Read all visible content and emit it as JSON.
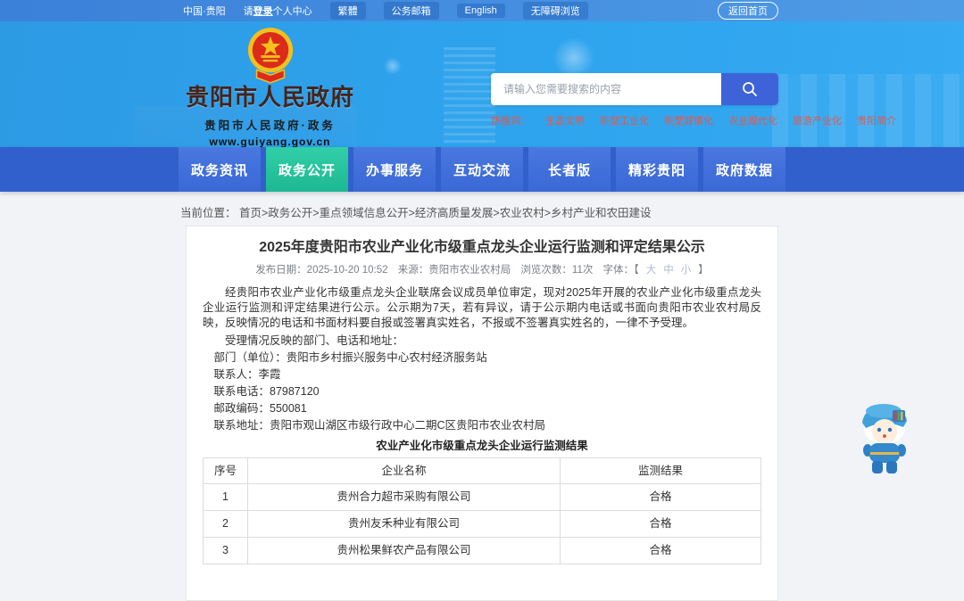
{
  "topbar": {
    "region": "中国·贵阳",
    "login_prefix": "请",
    "login_strong": "登录",
    "login_suffix": "个人中心",
    "pills": [
      "繁體",
      "公务邮箱",
      "English",
      "无障碍浏览"
    ],
    "home_button": "返回首页"
  },
  "header": {
    "site_name": "贵阳市人民政府",
    "site_subtitle": "贵阳市人民政府·政务",
    "site_url": "www.guiyang.gov.cn",
    "search": {
      "placeholder": "请输入您需要搜索的内容",
      "value": ""
    },
    "hot_label": "热搜词：",
    "hot_words": [
      "生态文明",
      "新型工业化",
      "新型城镇化",
      "农业现代化",
      "旅游产业化",
      "贵阳简介"
    ]
  },
  "nav": {
    "tabs": [
      {
        "label": "政务资讯"
      },
      {
        "label": "政务公开"
      },
      {
        "label": "办事服务"
      },
      {
        "label": "互动交流"
      },
      {
        "label": "长者版"
      },
      {
        "label": "精彩贵阳"
      },
      {
        "label": "政府数据"
      }
    ],
    "active_tab": "政务公开"
  },
  "breadcrumb": {
    "label": "当前位置：",
    "path": "首页>政务公开>重点领域信息公开>经济高质量发展>农业农村>乡村产业和农田建设"
  },
  "article": {
    "title": "2025年度贵阳市农业产业化市级重点龙头企业运行监测和评定结果公示",
    "meta": {
      "published": "发布日期：2025-10-20 10:52",
      "source": "来源：贵阳市农业农村局",
      "views": "浏览次数：11次",
      "font_prefix": "字体：【",
      "font_sizes": [
        "大",
        "中",
        "小"
      ],
      "font_suffix": "】"
    },
    "paragraph1": "经贵阳市农业产业化市级重点龙头企业联席会议成员单位审定，现对2025年开展的农业产业化市级重点龙头企业运行监测和评定结果进行公示。公示期为7天，若有异议，请于公示期内电话或书面向贵阳市农业农村局反映，反映情况的电话和书面材料要自报或签署真实姓名，不报或不签署真实姓名的，一律不予受理。",
    "paragraph2": "受理情况反映的部门、电话和地址：",
    "contacts": [
      "部门（单位）：贵阳市乡村振兴服务中心农村经济服务站",
      "联系人：李霞",
      "联系电话：87987120",
      "邮政编码：550081",
      "联系地址：贵阳市观山湖区市级行政中心二期C区贵阳市农业农村局"
    ],
    "table": {
      "caption": "农业产业化市级重点龙头企业运行监测结果",
      "headers": [
        "序号",
        "企业名称",
        "监测结果"
      ],
      "rows": [
        [
          "1",
          "贵州合力超市采购有限公司",
          "合格"
        ],
        [
          "2",
          "贵州友禾种业有限公司",
          "合格"
        ],
        [
          "3",
          "贵州松果鲜农产品有限公司",
          "合格"
        ]
      ]
    }
  },
  "colors": {
    "topbar_blue": "#3b80d9",
    "banner_blue": "#2ea4ee",
    "nav_blue": "#3160cc",
    "active_tab_teal": "#1db893",
    "hot_word_red": "#e8564a",
    "search_button_blue": "#3e63d9",
    "emblem_red": "#dc2a1b",
    "emblem_gold": "#f3c01c",
    "logo_text_brown": "#45241a"
  }
}
